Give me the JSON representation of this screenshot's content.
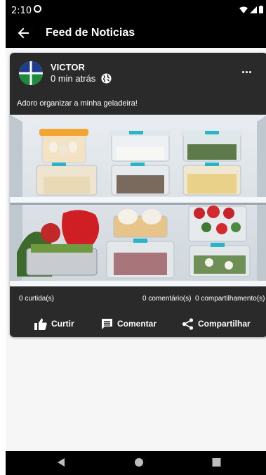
{
  "status_bar": {
    "time": "2:10"
  },
  "app_bar": {
    "title": "Feed de Noticias"
  },
  "post": {
    "author": "VICTOR",
    "time": "0 min atrás",
    "text": "Adoro organizar a minha geladeira!",
    "likes": "0 curtida(s)",
    "comments": "0 comentário(s)",
    "shares": "0 compartilhamento(s)",
    "actions": {
      "like": "Curtir",
      "comment": "Comentar",
      "share": "Compartilhar"
    }
  },
  "colors": {
    "app_bar": "#000000",
    "card": "#2a2a2a",
    "background": "#f6f6f6",
    "text": "#ffffff"
  },
  "icons": [
    "back-arrow-icon",
    "globe-icon",
    "more-options-icon",
    "thumbs-up-icon",
    "comment-icon",
    "share-icon",
    "nav-back-icon",
    "nav-home-icon",
    "nav-recents-icon",
    "wifi-icon",
    "signal-icon",
    "battery-icon"
  ]
}
